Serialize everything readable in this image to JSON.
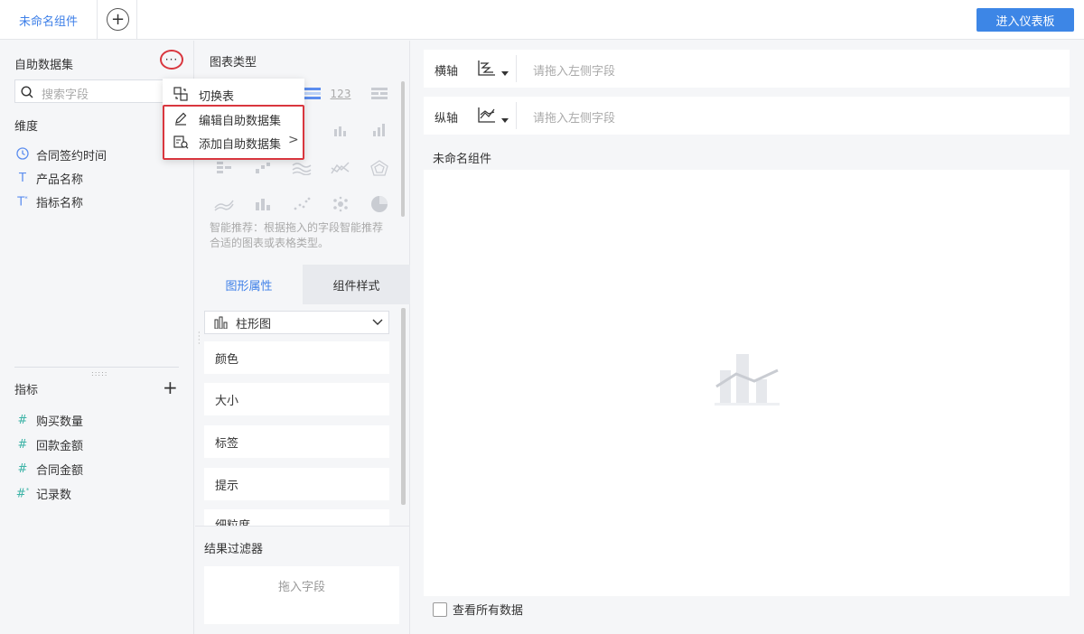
{
  "topbar": {
    "active_tab": "未命名组件",
    "add_tab_label": "+",
    "enter_dashboard": "进入仪表板"
  },
  "left_panel": {
    "title": "自助数据集",
    "more_label": "···",
    "search_placeholder": "搜索字段",
    "dimensions_label": "维度",
    "dimensions": [
      {
        "icon": "clock-icon",
        "label": "合同签约时间"
      },
      {
        "icon": "text-icon",
        "label": "产品名称"
      },
      {
        "icon": "text-calc-icon",
        "label": "指标名称"
      }
    ],
    "metrics_label": "指标",
    "metrics": [
      {
        "icon": "number-icon",
        "label": "购买数量"
      },
      {
        "icon": "number-icon",
        "label": "回款金额"
      },
      {
        "icon": "number-icon",
        "label": "合同金额"
      },
      {
        "icon": "number-calc-icon",
        "label": "记录数"
      }
    ]
  },
  "dropdown": {
    "items": [
      {
        "icon": "switch-table-icon",
        "label": "切换表"
      },
      {
        "icon": "edit-icon",
        "label": "编辑自助数据集"
      },
      {
        "icon": "add-dataset-icon",
        "label": "添加自助数据集",
        "submenu": ">"
      }
    ]
  },
  "middle_panel": {
    "chart_type_title": "图表类型",
    "number_icon_text": "123",
    "hint": "智能推荐：根据拖入的字段智能推荐合适的图表或表格类型。",
    "tabs": [
      "图形属性",
      "组件样式"
    ],
    "chart_select": "柱形图",
    "properties": [
      "颜色",
      "大小",
      "标签",
      "提示",
      "细粒度"
    ],
    "filter_title": "结果过滤器",
    "filter_placeholder": "拖入字段"
  },
  "right_panel": {
    "x_axis_label": "横轴",
    "y_axis_label": "纵轴",
    "axis_placeholder": "请拖入左侧字段",
    "canvas_title": "未命名组件",
    "view_all_label": "查看所有数据"
  },
  "colors": {
    "accent": "#3d86e6",
    "highlight_red": "#d9363e",
    "number_field": "#3cb3a6",
    "dimension_field": "#5b8def"
  }
}
